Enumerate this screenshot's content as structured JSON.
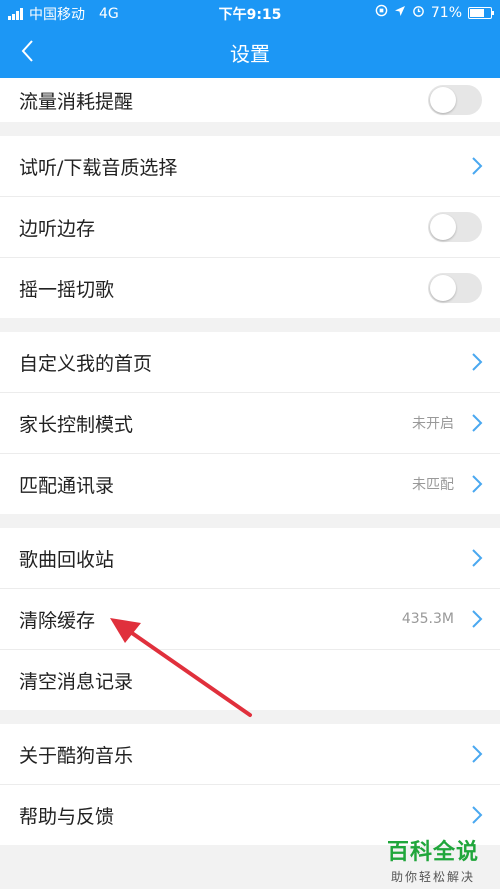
{
  "status_bar": {
    "carrier": "中国移动",
    "network": "4G",
    "time": "下午9:15",
    "battery": "71%",
    "battery_level": 0.71
  },
  "nav": {
    "title": "设置"
  },
  "groups": [
    [
      {
        "label": "流量消耗提醒",
        "control": "toggle",
        "on": false
      }
    ],
    [
      {
        "label": "试听/下载音质选择",
        "control": "chevron"
      },
      {
        "label": "边听边存",
        "control": "toggle",
        "on": false
      },
      {
        "label": "摇一摇切歌",
        "control": "toggle",
        "on": false
      }
    ],
    [
      {
        "label": "自定义我的首页",
        "control": "chevron"
      },
      {
        "label": "家长控制模式",
        "value": "未开启",
        "control": "chevron"
      },
      {
        "label": "匹配通讯录",
        "value": "未匹配",
        "control": "chevron"
      }
    ],
    [
      {
        "label": "歌曲回收站",
        "control": "chevron"
      },
      {
        "label": "清除缓存",
        "value": "435.3M",
        "control": "chevron"
      },
      {
        "label": "清空消息记录",
        "control": "none"
      }
    ],
    [
      {
        "label": "关于酷狗音乐",
        "control": "chevron"
      },
      {
        "label": "帮助与反馈",
        "control": "chevron"
      }
    ]
  ],
  "watermark": {
    "title": "百科全说",
    "subtitle": "助你轻松解决"
  },
  "colors": {
    "header": "#1c97f5",
    "chevron": "#4aa8f0",
    "arrow": "#e0303c",
    "watermark": "#20a63b"
  }
}
